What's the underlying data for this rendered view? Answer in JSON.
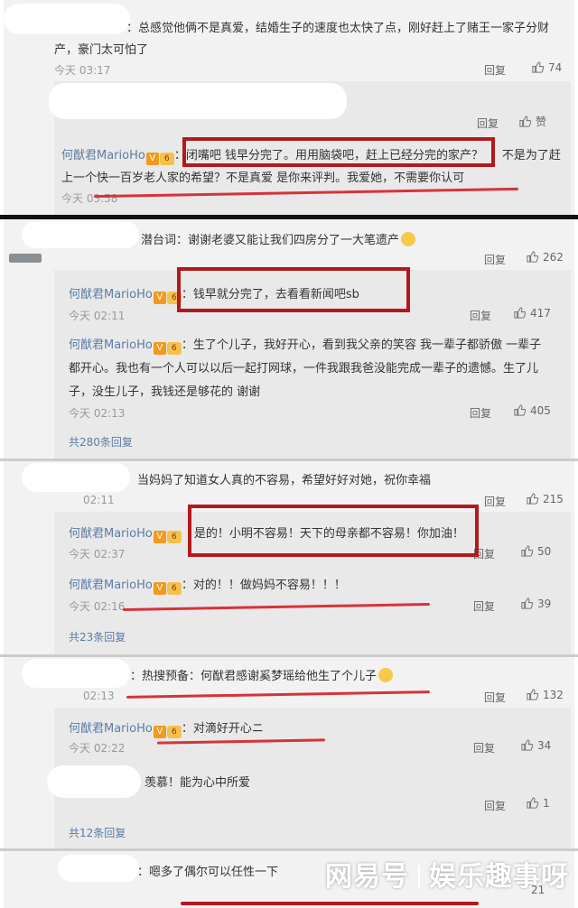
{
  "labels": {
    "reply": "回复",
    "like_text": "赞"
  },
  "badges": {
    "v": "V",
    "level": "6"
  },
  "accent": {
    "box_red": "#b3191c",
    "underline_red": "#d8323a",
    "username_blue": "#5b7ca6"
  },
  "icons": {
    "like": "thumbs-up-icon",
    "emoji": "doge-emoji-icon"
  },
  "c1": {
    "text1": "：总感觉他俩不是真爱，结婚生子的速度也太快了点，刚好赶上了赌王一家子分财",
    "text2": "产，豪门太可怕了",
    "time": "今天 03:17",
    "likes": "74",
    "r1_likes": "赞",
    "r2": {
      "user": "何猷君MarioHo",
      "colon": "：",
      "boxed": "闭嘴吧 钱早分完了。用用脑袋吧，赶上已经分完的家产？",
      "rest1": "不是为了赶",
      "text2": "上一个快一百岁老人家的希望？不是真爱 是你来评判。我爱她，不需要你认可",
      "time": "今天 03:58"
    }
  },
  "c2": {
    "text": "潜台词：谢谢老婆又能让我们四房分了一大笔遗产",
    "likes": "262",
    "r1": {
      "user": "何猷君MarioHo",
      "text": "：钱早就分完了，去看看新闻吧sb",
      "time": "今天 02:11",
      "likes": "417"
    },
    "r2": {
      "user": "何猷君MarioHo",
      "text1": "：生了个儿子，我好开心，看到我父亲的笑容 我一辈子都骄傲 一辈子",
      "text2": "都开心。我也有一个人可以以后一起打网球，一件我跟我爸没能完成一辈子的遗憾。生了儿",
      "text3": "子，没生儿子，我钱还是够花的 谢谢",
      "time": "今天 02:13",
      "likes": "405"
    },
    "more": "共280条回复"
  },
  "c3": {
    "text": "当妈妈了知道女人真的不容易，希望好好对她，祝你幸福",
    "time": "02:11",
    "likes": "215",
    "r1": {
      "user": "何猷君MarioHo",
      "text": "是的！小明不容易！天下的母亲都不容易！你加油！",
      "time": "今天 02:37",
      "likes": "50"
    },
    "r2": {
      "user": "何猷君MarioHo",
      "text": "：对的！！做妈妈不容易！！！",
      "time": "今天 02:16",
      "likes": "39"
    },
    "more": "共23条回复"
  },
  "c4": {
    "text": "：热搜预备：何猷君感谢奚梦瑶给他生了个儿子",
    "time": "02:13",
    "likes": "132",
    "r1": {
      "user": "何猷君MarioHo",
      "text": "：对滴好开心ニ",
      "time": "今天 02:22",
      "likes": "34"
    }
  },
  "c5": {
    "text": "羡慕！能为心中所爱",
    "likes": "1",
    "more": "共12条回复"
  },
  "c6": {
    "text": "：嗯多了偶尔可以任性一下",
    "likes": "21"
  },
  "watermark": {
    "left": "网易号",
    "right": "娱乐趣事呀"
  }
}
